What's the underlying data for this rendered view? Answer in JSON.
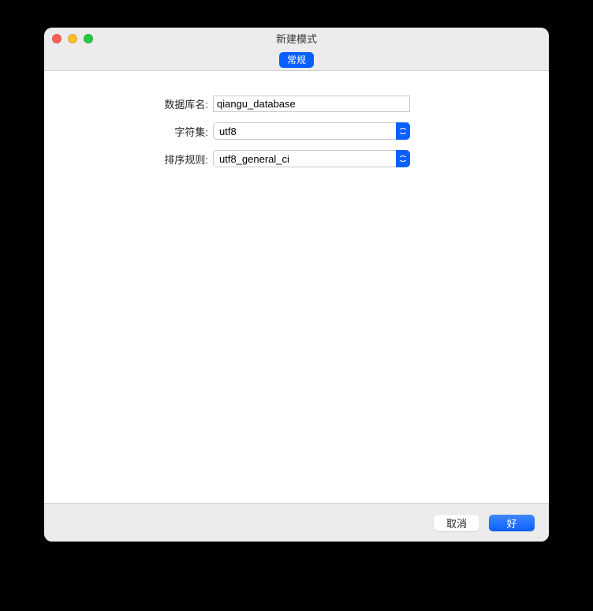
{
  "window": {
    "title": "新建模式"
  },
  "toolbar": {
    "tab_general": "常规"
  },
  "form": {
    "db_name_label": "数据库名:",
    "db_name_value": "qiangu_database",
    "charset_label": "字符集:",
    "charset_value": "utf8",
    "collation_label": "排序规则:",
    "collation_value": "utf8_general_ci"
  },
  "footer": {
    "cancel": "取消",
    "ok": "好"
  }
}
